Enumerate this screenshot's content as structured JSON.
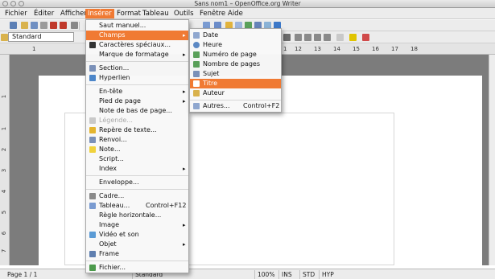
{
  "window": {
    "title": "Sans nom1 – OpenOffice.org Writer"
  },
  "menubar": [
    "Fichier",
    "Éditer",
    "Afficher",
    "Insérer",
    "Format",
    "Tableau",
    "Outils",
    "Fenêtre",
    "Aide"
  ],
  "toolbar": {
    "paragraph_style": "Standard"
  },
  "ruler": {
    "h_marks": [
      "1",
      "12",
      "13",
      "14",
      "15",
      "16",
      "17",
      "18"
    ],
    "v_marks": [
      "1",
      "1",
      "2",
      "3",
      "4",
      "5",
      "6",
      "7"
    ]
  },
  "insert_menu": {
    "items": [
      {
        "label": "Saut manuel..."
      },
      {
        "label": "Champs"
      },
      {
        "label": "Caractères spéciaux..."
      },
      {
        "label": "Marque de formatage"
      },
      {
        "label": "Section..."
      },
      {
        "label": "Hyperlien"
      },
      {
        "label": "En-tête"
      },
      {
        "label": "Pied de page"
      },
      {
        "label": "Note de bas de page..."
      },
      {
        "label": "Légende..."
      },
      {
        "label": "Repère de texte..."
      },
      {
        "label": "Renvoi..."
      },
      {
        "label": "Note..."
      },
      {
        "label": "Script..."
      },
      {
        "label": "Index"
      },
      {
        "label": "Enveloppe..."
      },
      {
        "label": "Cadre..."
      },
      {
        "label": "Tableau...",
        "shortcut": "Control+F12"
      },
      {
        "label": "Règle horizontale..."
      },
      {
        "label": "Image"
      },
      {
        "label": "Vidéo et son"
      },
      {
        "label": "Objet"
      },
      {
        "label": "Frame"
      },
      {
        "label": "Fichier..."
      }
    ]
  },
  "fields_menu": {
    "items": [
      {
        "label": "Date"
      },
      {
        "label": "Heure"
      },
      {
        "label": "Numéro de page"
      },
      {
        "label": "Nombre de pages"
      },
      {
        "label": "Sujet"
      },
      {
        "label": "Titre"
      },
      {
        "label": "Auteur"
      },
      {
        "label": "Autres...",
        "shortcut": "Control+F2"
      }
    ]
  },
  "status": {
    "page": "Page 1 / 1",
    "style": "Standard",
    "zoom": "100%",
    "ins": "INS",
    "std": "STD",
    "hyp": "HYP"
  },
  "colors": {
    "highlight": "#f07a33",
    "workspace": "#7c7c7c"
  }
}
